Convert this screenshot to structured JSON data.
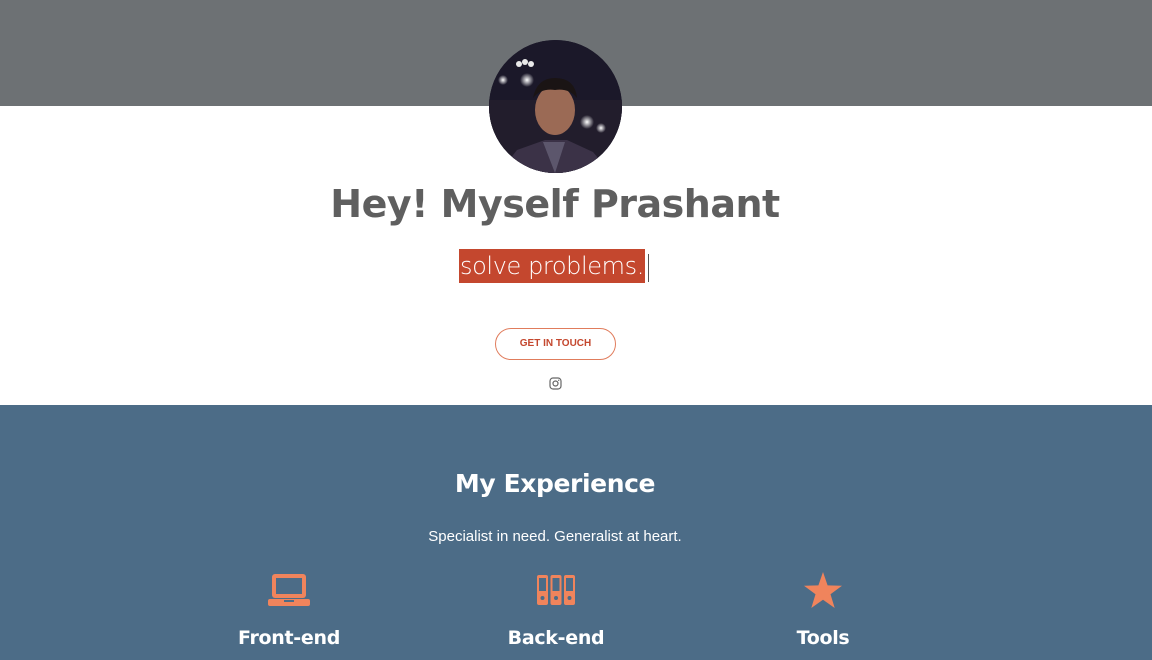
{
  "hero": {
    "title": "Hey! Myself Prashant",
    "typed_text": "solve problems.",
    "cta_label": "GET IN TOUCH"
  },
  "social": {
    "icon": "instagram-icon"
  },
  "experience": {
    "title": "My Experience",
    "subtitle": "Specialist in need. Generalist at heart.",
    "items": [
      {
        "label": "Front-end",
        "icon": "laptop-icon"
      },
      {
        "label": "Back-end",
        "icon": "server-icon"
      },
      {
        "label": "Tools",
        "icon": "star-icon"
      }
    ]
  },
  "colors": {
    "top_band": "#6d7174",
    "accent": "#c4472e",
    "icon_orange": "#f0845c",
    "section_bg": "#4c6c87",
    "title_gray": "#5f5f5f"
  }
}
